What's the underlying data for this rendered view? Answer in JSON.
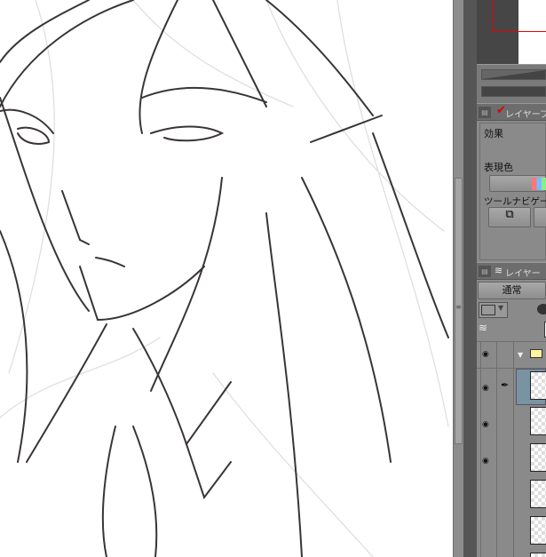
{
  "navigator": {
    "view_rect_color": "#e00000"
  },
  "layer_property_panel": {
    "title": "レイヤープ",
    "effect_label": "効果",
    "expression_color_label": "表現色",
    "tool_navigator_label": "ツールナビゲー"
  },
  "layer_panel": {
    "title": "レイヤー",
    "blend_mode": "通常",
    "layers": [
      {
        "type": "folder",
        "visible": true
      },
      {
        "type": "raster",
        "visible": true,
        "selected": true,
        "editing": true
      },
      {
        "type": "raster",
        "visible": true
      },
      {
        "type": "raster",
        "visible": true
      },
      {
        "type": "raster",
        "visible": false
      },
      {
        "type": "raster",
        "visible": false
      }
    ]
  },
  "colors": {
    "accent": "#e00000",
    "selected_layer": "#7a93a3"
  }
}
